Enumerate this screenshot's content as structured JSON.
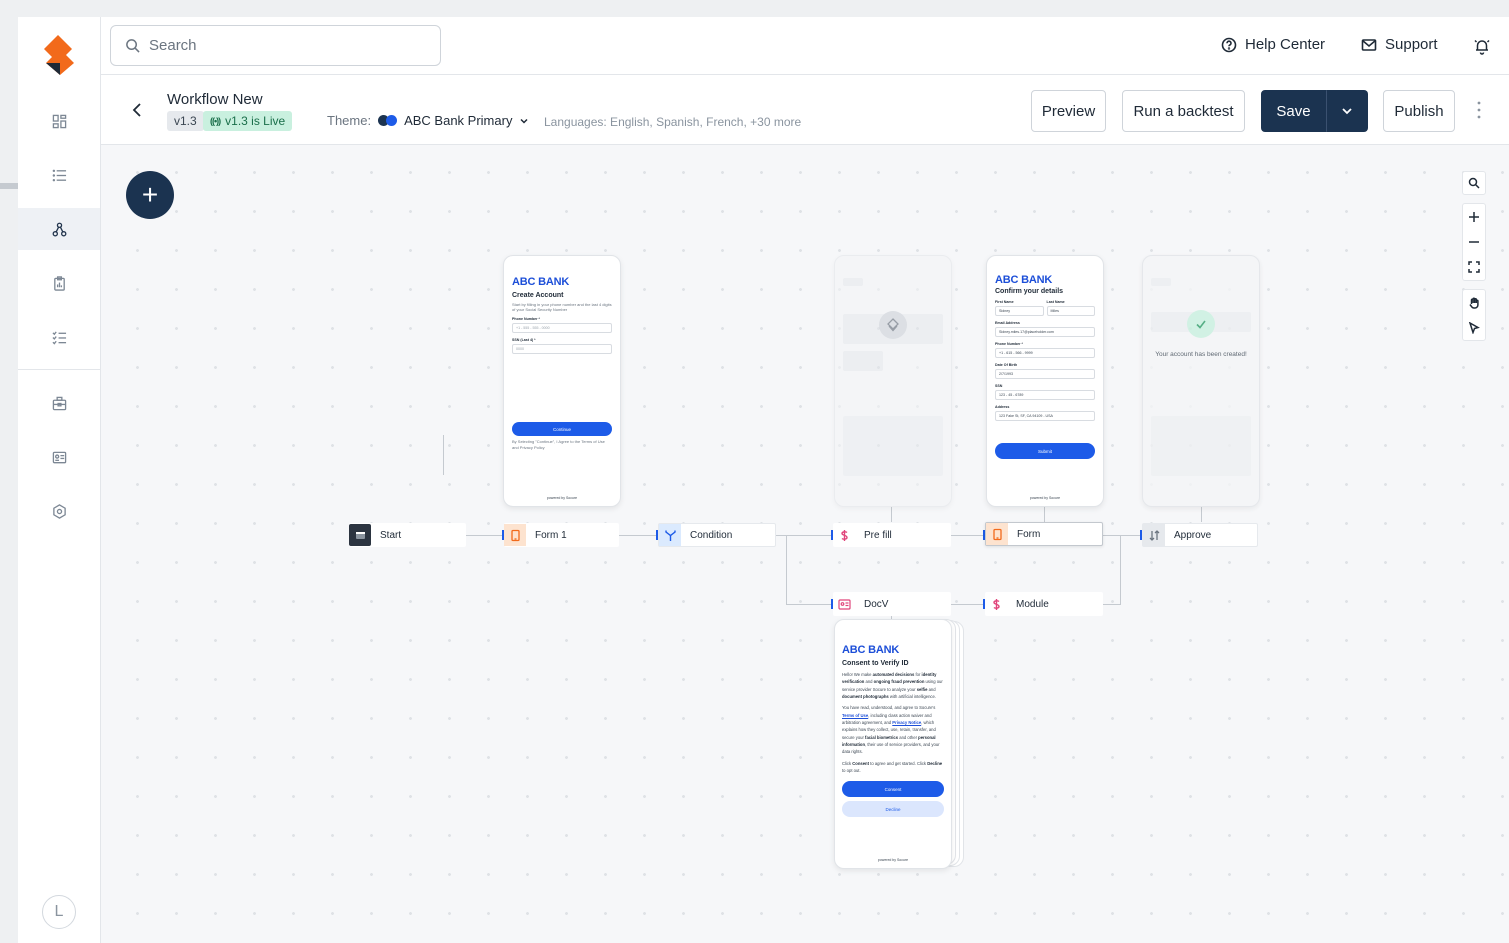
{
  "sidebar": {
    "items": [
      {
        "icon": "dashboard-icon"
      },
      {
        "icon": "list-icon"
      },
      {
        "icon": "workflow-icon"
      },
      {
        "icon": "clipboard-chart-icon"
      },
      {
        "icon": "checklist-icon"
      },
      {
        "icon": "briefcase-icon"
      },
      {
        "icon": "id-card-icon"
      },
      {
        "icon": "settings-hex-icon"
      }
    ],
    "avatar_initial": "L"
  },
  "topbar": {
    "search_placeholder": "Search",
    "help_center": "Help Center",
    "support": "Support"
  },
  "workflow": {
    "title": "Workflow New",
    "version": "v1.3",
    "live_status": "v1.3 is Live",
    "theme_label": "Theme:",
    "theme_value": "ABC Bank Primary",
    "languages": "Languages: English, Spanish, French, +30 more",
    "preview_label": "Preview",
    "backtest_label": "Run a backtest",
    "save_label": "Save",
    "publish_label": "Publish"
  },
  "colors": {
    "brand_orange": "#f26a1b",
    "primary_navy": "#1b3350",
    "accent_blue": "#1d5be8",
    "live_green": "#c9f0df"
  },
  "nodes": {
    "start": "Start",
    "form1": "Form 1",
    "condition": "Condition",
    "prefill": "Pre fill",
    "form": "Form",
    "approve": "Approve",
    "docv": "DocV",
    "module": "Module"
  },
  "screens": {
    "create_account": {
      "bank": "ABC BANK",
      "heading": "Create Account",
      "text": "Start by filling in your phone number and the last 4 digits of your Social Security Number",
      "phone_label": "Phone Number *",
      "phone_placeholder": "+1 - 555 - 555 - 0000",
      "ssn_label": "SSN (Last 4) *",
      "ssn_placeholder": "0000",
      "continue": "Continue",
      "terms": "By Selecting \"Continue\", I Agree to the Terms of Use and Privacy Policy",
      "powered": "powered by Socure"
    },
    "confirm_details": {
      "bank": "ABC BANK",
      "heading": "Confirm your details",
      "first_name_label": "First Name",
      "first_name": "Sidney",
      "last_name_label": "Last Name",
      "last_name": "Miles",
      "email_label": "Email Address",
      "email": "Sidney.miles.17@placeholder.com",
      "phone_label": "Phone Number *",
      "phone": "+1 - 615 - 566 - 9999",
      "dob_label": "Date Of Birth",
      "dob": "2/7/1993",
      "ssn_label": "SSN",
      "ssn": "123 - 45 - 6789",
      "address_label": "Address",
      "address": "123 Fake St, SF, CA 94109 - USA",
      "submit": "Submit",
      "powered": "powered by Socure"
    },
    "approve": {
      "message": "Your account has been created!"
    },
    "consent": {
      "bank": "ABC BANK",
      "heading": "Consent to Verify ID",
      "consent": "Consent",
      "decline": "Decline",
      "powered": "powered by Socure"
    }
  }
}
